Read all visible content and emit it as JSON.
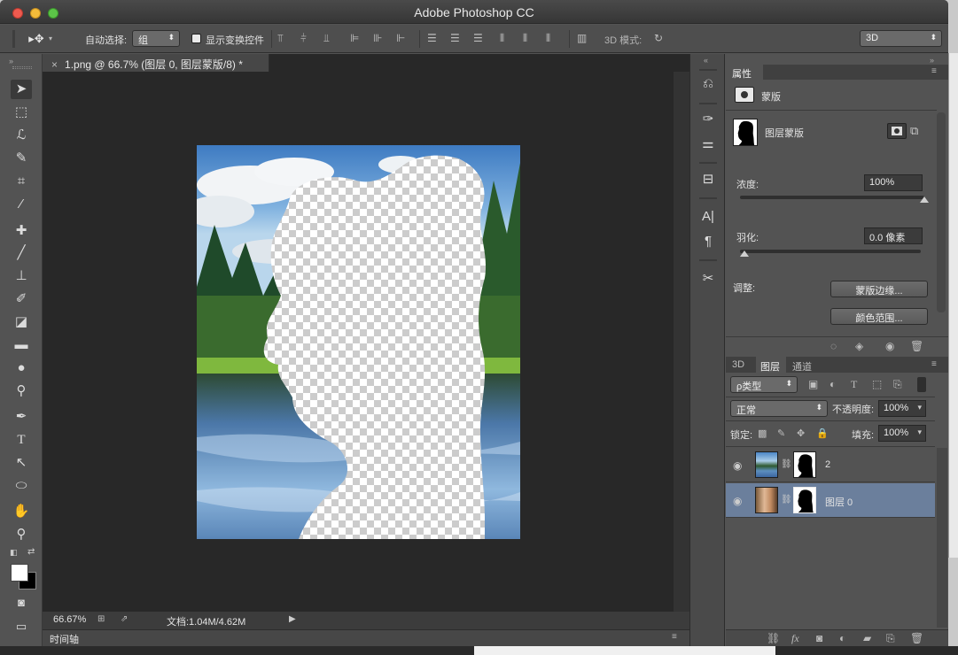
{
  "app": {
    "title": "Adobe Photoshop CC"
  },
  "options_bar": {
    "auto_select_label": "自动选择:",
    "auto_select_value": "组",
    "show_transform_label": "显示变换控件",
    "mode_3d_label": "3D 模式:",
    "workspace_value": "3D"
  },
  "document": {
    "tab_label": "1.png @ 66.7% (图层 0, 图层蒙版/8) *",
    "close_glyph": "×",
    "zoom": "66.67%",
    "doc_size": "文档:1.04M/4.62M"
  },
  "timeline": {
    "label": "时间轴"
  },
  "properties": {
    "tab": "属性",
    "mask_header": "蒙版",
    "mask_type": "图层蒙版",
    "density_label": "浓度:",
    "density_value": "100%",
    "density_level": 100,
    "feather_label": "羽化:",
    "feather_value": "0.0 像素",
    "feather_level": 0,
    "adjust_label": "调整:",
    "mask_edge_button": "蒙版边缘...",
    "color_range_button": "颜色范围..."
  },
  "layers_panel": {
    "tabs": [
      "3D",
      "图层",
      "通道"
    ],
    "active_tab": 1,
    "filter_label": "ρ类型",
    "blend_mode": "正常",
    "opacity_label": "不透明度:",
    "opacity_value": "100%",
    "lock_label": "锁定:",
    "fill_label": "填充:",
    "fill_value": "100%",
    "layers": [
      {
        "name": "2",
        "selected": false,
        "visible": true
      },
      {
        "name": "图层 0",
        "selected": true,
        "visible": true
      }
    ]
  },
  "colors": {
    "selected_layer": "#6b7f9c",
    "panel_bg": "#535353",
    "canvas_bg": "#282828"
  }
}
